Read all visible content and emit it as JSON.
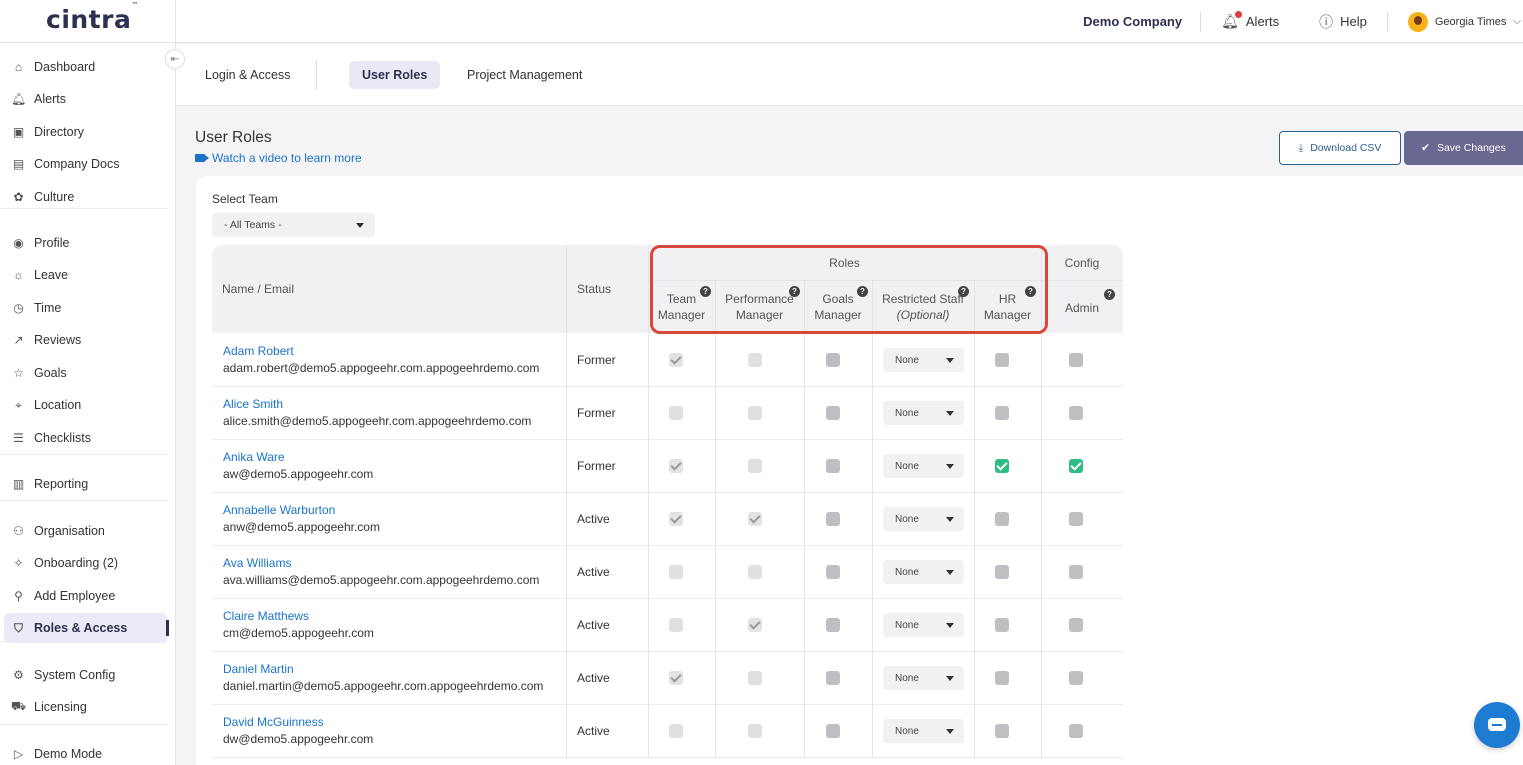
{
  "header": {
    "logo": "cintra",
    "logo_mark": "™",
    "company": "Demo Company",
    "alerts": "Alerts",
    "help": "Help",
    "user": "Georgia Times"
  },
  "sidebar": {
    "items": [
      {
        "label": "Dashboard",
        "icon": "home-icon"
      },
      {
        "label": "Alerts",
        "icon": "bell-icon"
      },
      {
        "label": "Directory",
        "icon": "directory-icon"
      },
      {
        "label": "Company Docs",
        "icon": "document-icon"
      },
      {
        "label": "Culture",
        "icon": "culture-icon"
      },
      {
        "label": "Profile",
        "icon": "profile-icon"
      },
      {
        "label": "Leave",
        "icon": "leave-icon"
      },
      {
        "label": "Time",
        "icon": "clock-icon"
      },
      {
        "label": "Reviews",
        "icon": "trend-icon"
      },
      {
        "label": "Goals",
        "icon": "star-icon"
      },
      {
        "label": "Location",
        "icon": "location-icon"
      },
      {
        "label": "Checklists",
        "icon": "checklist-icon"
      },
      {
        "label": "Reporting",
        "icon": "chart-icon"
      },
      {
        "label": "Organisation",
        "icon": "org-icon"
      },
      {
        "label": "Onboarding (2)",
        "icon": "onboarding-icon"
      },
      {
        "label": "Add Employee",
        "icon": "add-user-icon"
      },
      {
        "label": "Roles & Access",
        "icon": "shield-icon"
      },
      {
        "label": "System Config",
        "icon": "gear-icon"
      },
      {
        "label": "Licensing",
        "icon": "cart-icon"
      },
      {
        "label": "Demo Mode",
        "icon": "play-icon"
      }
    ]
  },
  "tabs": [
    "Login & Access",
    "User Roles",
    "Project Management"
  ],
  "page": {
    "title": "User Roles",
    "video_link": "Watch a video to learn more",
    "download_csv": "Download CSV",
    "save_changes": "Save Changes",
    "select_team_label": "Select Team",
    "select_team_value": "- All Teams -"
  },
  "table": {
    "col_name": "Name / Email",
    "col_status": "Status",
    "group_roles": "Roles",
    "group_config": "Config",
    "roles": [
      {
        "line1": "Team",
        "line2": "Manager"
      },
      {
        "line1": "Performance",
        "line2": "Manager"
      },
      {
        "line1": "Goals",
        "line2": "Manager"
      },
      {
        "line1": "Restricted Staff",
        "line2": "(Optional)"
      },
      {
        "line1": "HR",
        "line2": "Manager"
      }
    ],
    "admin": "Admin",
    "rows": [
      {
        "name": "Adam Robert",
        "email": "adam.robert@demo5.appogeehr.com.appogeehrdemo.com",
        "status": "Former",
        "team": "checked-disabled",
        "perf": "disabled",
        "goals": "off",
        "restricted": "None",
        "hr": "off",
        "admin": "off"
      },
      {
        "name": "Alice Smith",
        "email": "alice.smith@demo5.appogeehr.com.appogeehrdemo.com",
        "status": "Former",
        "team": "disabled",
        "perf": "disabled",
        "goals": "off",
        "restricted": "None",
        "hr": "off",
        "admin": "off"
      },
      {
        "name": "Anika Ware",
        "email": "aw@demo5.appogeehr.com",
        "status": "Former",
        "team": "checked-disabled",
        "perf": "disabled",
        "goals": "off",
        "restricted": "None",
        "hr": "on",
        "admin": "on"
      },
      {
        "name": "Annabelle Warburton",
        "email": "anw@demo5.appogeehr.com",
        "status": "Active",
        "team": "checked-disabled",
        "perf": "checked-disabled",
        "goals": "off",
        "restricted": "None",
        "hr": "off",
        "admin": "off"
      },
      {
        "name": "Ava Williams",
        "email": "ava.williams@demo5.appogeehr.com.appogeehrdemo.com",
        "status": "Active",
        "team": "disabled",
        "perf": "disabled",
        "goals": "off",
        "restricted": "None",
        "hr": "off",
        "admin": "off"
      },
      {
        "name": "Claire Matthews",
        "email": "cm@demo5.appogeehr.com",
        "status": "Active",
        "team": "disabled",
        "perf": "checked-disabled",
        "goals": "off",
        "restricted": "None",
        "hr": "off",
        "admin": "off"
      },
      {
        "name": "Daniel Martin",
        "email": "daniel.martin@demo5.appogeehr.com.appogeehrdemo.com",
        "status": "Active",
        "team": "checked-disabled",
        "perf": "disabled",
        "goals": "off",
        "restricted": "None",
        "hr": "off",
        "admin": "off"
      },
      {
        "name": "David McGuinness",
        "email": "dw@demo5.appogeehr.com",
        "status": "Active",
        "team": "disabled",
        "perf": "disabled",
        "goals": "off",
        "restricted": "None",
        "hr": "off",
        "admin": "off"
      }
    ]
  },
  "colors": {
    "brand": "#2d3150",
    "link": "#1a73c8",
    "check_on": "#2ebd85",
    "highlight": "#d9473a",
    "save_bg": "#6a6890"
  }
}
